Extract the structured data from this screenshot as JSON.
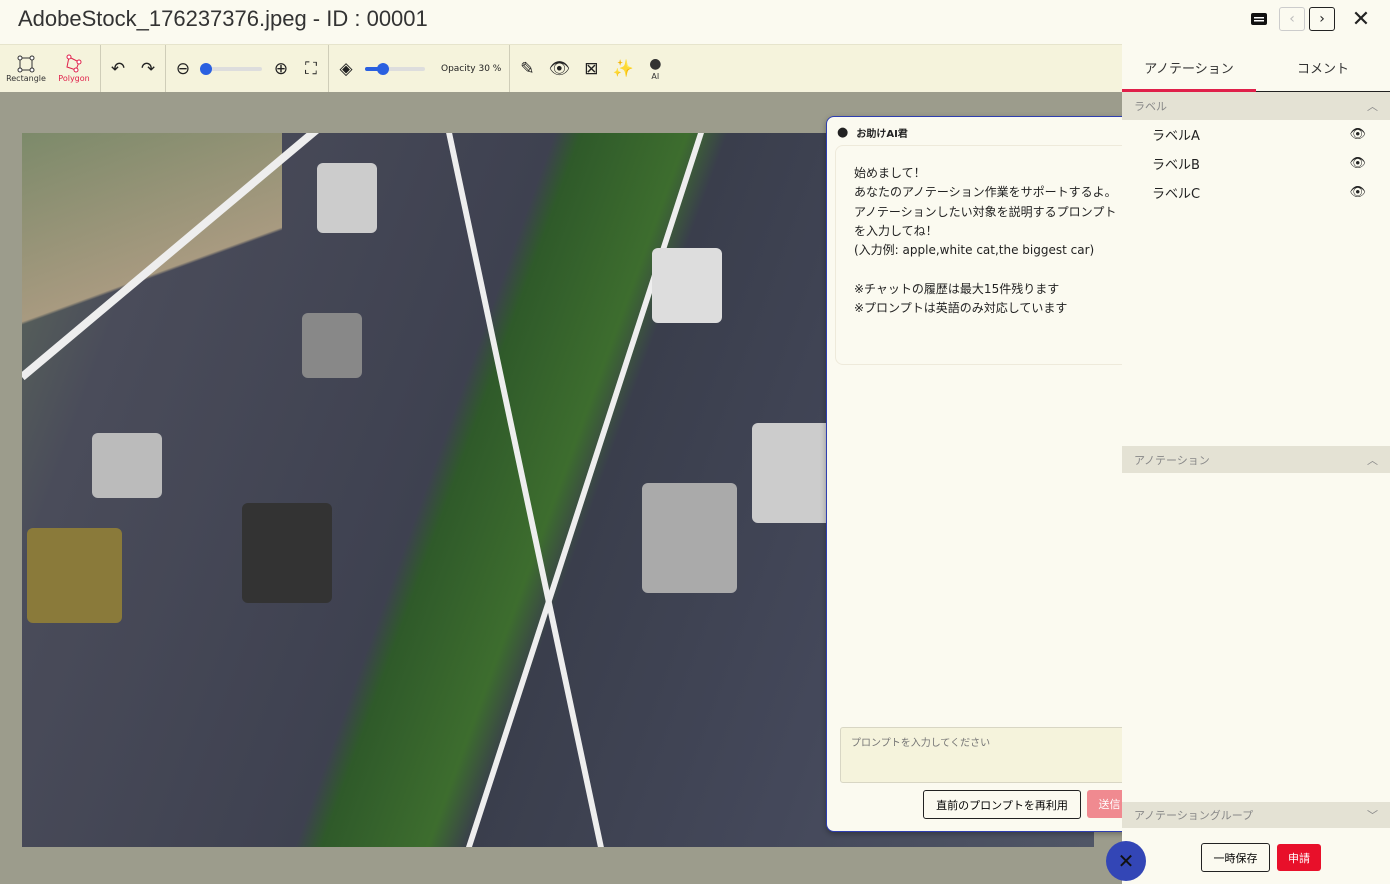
{
  "window": {
    "title": "AdobeStock_176237376.jpeg - ID : 00001"
  },
  "toolbar": {
    "rectangle_label": "Rectangle",
    "polygon_label": "Polygon",
    "opacity_label": "Opacity 30 %",
    "opacity_value": 30,
    "zoom_value": 0,
    "ai_label": "AI",
    "accent": "#2a60e0"
  },
  "chat": {
    "title": "お助けAI君",
    "message": "始めまして！\nあなたのアノテーション作業をサポートするよ。\nアノテーションしたい対象を説明するプロンプトを入力してね！\n(入力例: apple,white cat,the biggest car)\n\n※チャットの履歴は最大15件残ります\n※プロンプトは英語のみ対応しています",
    "prompt_placeholder": "プロンプトを入力してください",
    "prompt_value": "",
    "reuse_label": "直前のプロンプトを再利用",
    "send_label": "送信"
  },
  "right": {
    "tabs": [
      {
        "label": "アノテーション",
        "active": true
      },
      {
        "label": "コメント",
        "active": false
      }
    ],
    "label_section": "ラベル",
    "labels": [
      "ラベルA",
      "ラベルB",
      "ラベルC"
    ],
    "annotation_section": "アノテーション",
    "group_section": "アノテーショングループ",
    "save_label": "一時保存",
    "apply_label": "申請",
    "tab_accent": "#e0204a"
  }
}
